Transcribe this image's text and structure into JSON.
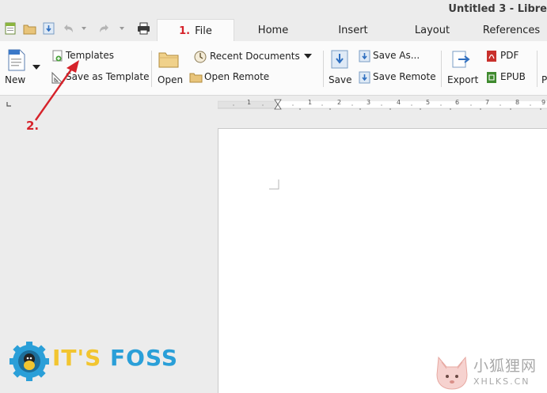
{
  "window": {
    "title": "Untitled 3 - Libre"
  },
  "quick_access": {
    "icons": [
      "new-document-icon",
      "open-folder-icon",
      "save-icon",
      "undo-icon",
      "undo-dropdown-icon",
      "redo-icon",
      "redo-dropdown-icon",
      "print-icon"
    ]
  },
  "tabs": [
    {
      "label": "File",
      "step": "1.",
      "active": true
    },
    {
      "label": "Home"
    },
    {
      "label": "Insert"
    },
    {
      "label": "Layout"
    },
    {
      "label": "References"
    }
  ],
  "ribbon": {
    "new_label": "New",
    "templates_label": "Templates",
    "save_as_template_label": "Save as Template",
    "open_label": "Open",
    "recent_documents_label": "Recent Documents",
    "open_remote_label": "Open Remote",
    "save_label": "Save",
    "save_as_label": "Save As...",
    "save_remote_label": "Save Remote",
    "export_label": "Export",
    "pdf_label": "PDF",
    "epub_label": "EPUB",
    "partial_label": "P"
  },
  "ruler": {
    "ticks": [
      "1",
      "1",
      "2",
      "3",
      "4",
      "5",
      "6",
      "7",
      "8",
      "9"
    ]
  },
  "annotations": {
    "step2_label": "2.",
    "accent_color": "#d6222a"
  },
  "logo": {
    "part1": "IT'S",
    "part2": "FOSS",
    "color_part1": "#f2c530",
    "color_part2": "#2a9fd8"
  },
  "watermark": {
    "line1": "小狐狸网",
    "line2": "XHLKS.CN"
  }
}
